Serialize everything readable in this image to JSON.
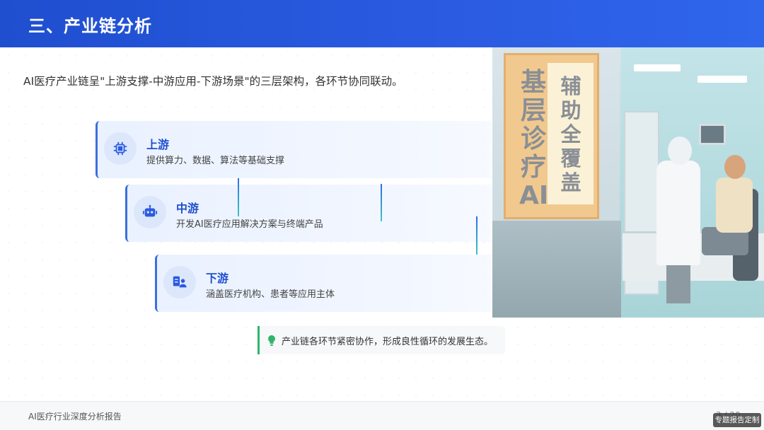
{
  "header": {
    "title": "三、产业链分析"
  },
  "intro": "AI医疗产业链呈\"上游支撑-中游应用-下游场景\"的三层架构，各环节协同联动。",
  "illustration": {
    "sign_left": "基层诊疗AI",
    "sign_right": "辅助全覆盖"
  },
  "tiers": [
    {
      "name": "上游",
      "desc": "提供算力、数据、算法等基础支撑",
      "icon": "chip-icon"
    },
    {
      "name": "中游",
      "desc": "开发AI医疗应用解决方案与终端产品",
      "icon": "robot-icon"
    },
    {
      "name": "下游",
      "desc": "涵盖医疗机构、患者等应用主体",
      "icon": "user-id-icon"
    }
  ],
  "note": {
    "text": "产业链各环节紧密协作，形成良性循环的发展生态。",
    "icon": "lightbulb-icon"
  },
  "footer": {
    "title": "AI医疗行业深度分析报告",
    "page": "3 / 20"
  },
  "badge": "专题报告定制",
  "colors": {
    "primary": "#1f4fcf",
    "accent_green": "#2fb56a",
    "tier_bg": "#e9f1ff"
  }
}
